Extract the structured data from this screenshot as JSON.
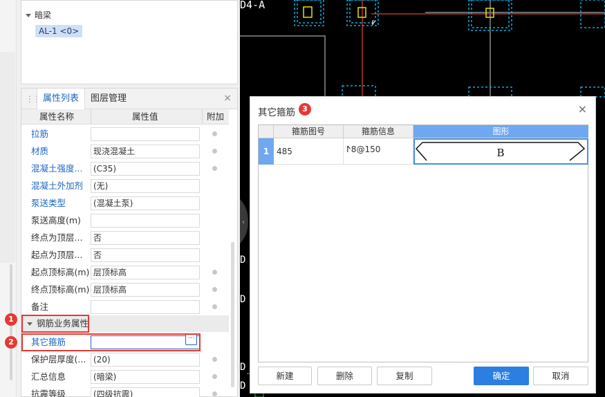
{
  "tree": {
    "group_label": "暗梁",
    "child_label": "AL-1 <0>"
  },
  "property_panel": {
    "tabs": [
      "属性列表",
      "图层管理"
    ],
    "close_glyph": "×",
    "headers": [
      "属性名称",
      "属性值",
      "附加"
    ],
    "rows": [
      {
        "name": "拉筋",
        "value": "",
        "blue": true,
        "dot": true
      },
      {
        "name": "材质",
        "value": "现浇混凝土",
        "blue": true,
        "dot": true
      },
      {
        "name": "混凝土强度...",
        "value": "(C35)",
        "blue": true,
        "dot": true
      },
      {
        "name": "混凝土外加剂",
        "value": "(无)",
        "blue": true,
        "dot": false
      },
      {
        "name": "泵送类型",
        "value": "(混凝土泵)",
        "blue": true,
        "dot": false
      },
      {
        "name": "泵送高度(m)",
        "value": "",
        "blue": false,
        "dot": false
      },
      {
        "name": "终点为顶层...",
        "value": "否",
        "blue": false,
        "dot": false
      },
      {
        "name": "起点为顶层...",
        "value": "否",
        "blue": false,
        "dot": false
      },
      {
        "name": "起点顶标高(m)",
        "value": "层顶标高",
        "blue": false,
        "dot": true
      },
      {
        "name": "终点顶标高(m)",
        "value": "层顶标高",
        "blue": false,
        "dot": true
      },
      {
        "name": "备注",
        "value": "",
        "blue": false,
        "dot": true
      }
    ],
    "group": "钢筋业务属性",
    "other_stirrup": {
      "name": "其它箍筋",
      "value": "",
      "button": "···"
    },
    "rows_after": [
      {
        "name": "保护层厚度(...",
        "value": "(20)",
        "blue": false,
        "dot": true
      },
      {
        "name": "汇总信息",
        "value": "(暗梁)",
        "blue": false,
        "dot": true
      },
      {
        "name": "抗震等级",
        "value": "(四级抗震)",
        "blue": false,
        "dot": true
      }
    ]
  },
  "badges": [
    "1",
    "2",
    "3"
  ],
  "cad": {
    "label": "D4-A",
    "side_marks": [
      "D",
      "D",
      "D",
      "D"
    ]
  },
  "dialog": {
    "title": "其它箍筋",
    "close_glyph": "×",
    "columns": [
      "箍筋图号",
      "箍筋信息",
      "图形"
    ],
    "rows": [
      {
        "index": "1",
        "figure_no": "485",
        "info": "ⵤ8@150",
        "shape_label": "B"
      }
    ],
    "buttons": {
      "new": "新建",
      "delete": "删除",
      "copy": "复制",
      "ok": "确定",
      "cancel": "取消"
    }
  },
  "colors": {
    "accent_blue": "#1a66c4",
    "highlight_red": "#e53935",
    "cad_background": "#000000",
    "cad_cyan": "#00b4e6",
    "cad_yellow": "#e6e600",
    "cad_red": "#c03030",
    "selected_header": "#6fa8f0",
    "primary_button": "#2b7fe0"
  }
}
